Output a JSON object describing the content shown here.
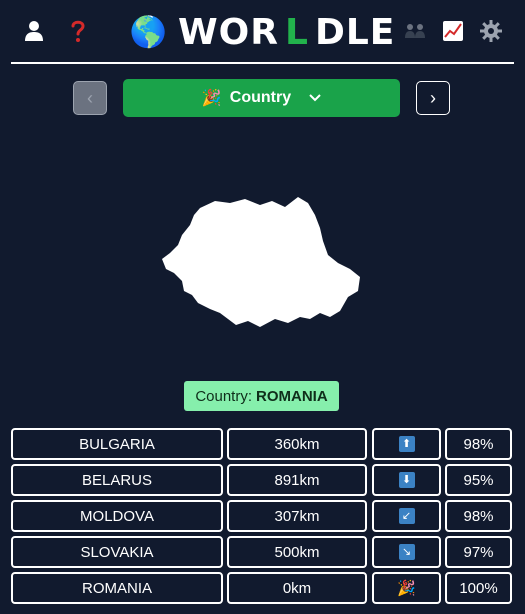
{
  "header": {
    "title_prefix": "WOR",
    "title_accent": "L",
    "title_suffix": "DLE",
    "icons": [
      "user-icon",
      "help-icon",
      "globe-icon",
      "people-icon",
      "stats-chart-icon",
      "gear-icon"
    ]
  },
  "nav": {
    "mode_label": "Country",
    "mode_icon": "🎉",
    "prev_symbol": "‹",
    "next_symbol": "›"
  },
  "answer": {
    "label": "Country:",
    "value": "ROMANIA"
  },
  "guesses": [
    {
      "country": "BULGARIA",
      "distance": "360km",
      "direction": "⬆",
      "percent": "98%"
    },
    {
      "country": "BELARUS",
      "distance": "891km",
      "direction": "⬇",
      "percent": "95%"
    },
    {
      "country": "MOLDOVA",
      "distance": "307km",
      "direction": "↙",
      "percent": "98%"
    },
    {
      "country": "SLOVAKIA",
      "distance": "500km",
      "direction": "↘",
      "percent": "97%"
    },
    {
      "country": "ROMANIA",
      "distance": "0km",
      "direction": "🎉",
      "percent": "100%"
    }
  ],
  "colors": {
    "background": "#111a2e",
    "accent_green": "#1aa34a",
    "badge_green": "#86efac",
    "arrow_blue": "#3b82c4"
  }
}
